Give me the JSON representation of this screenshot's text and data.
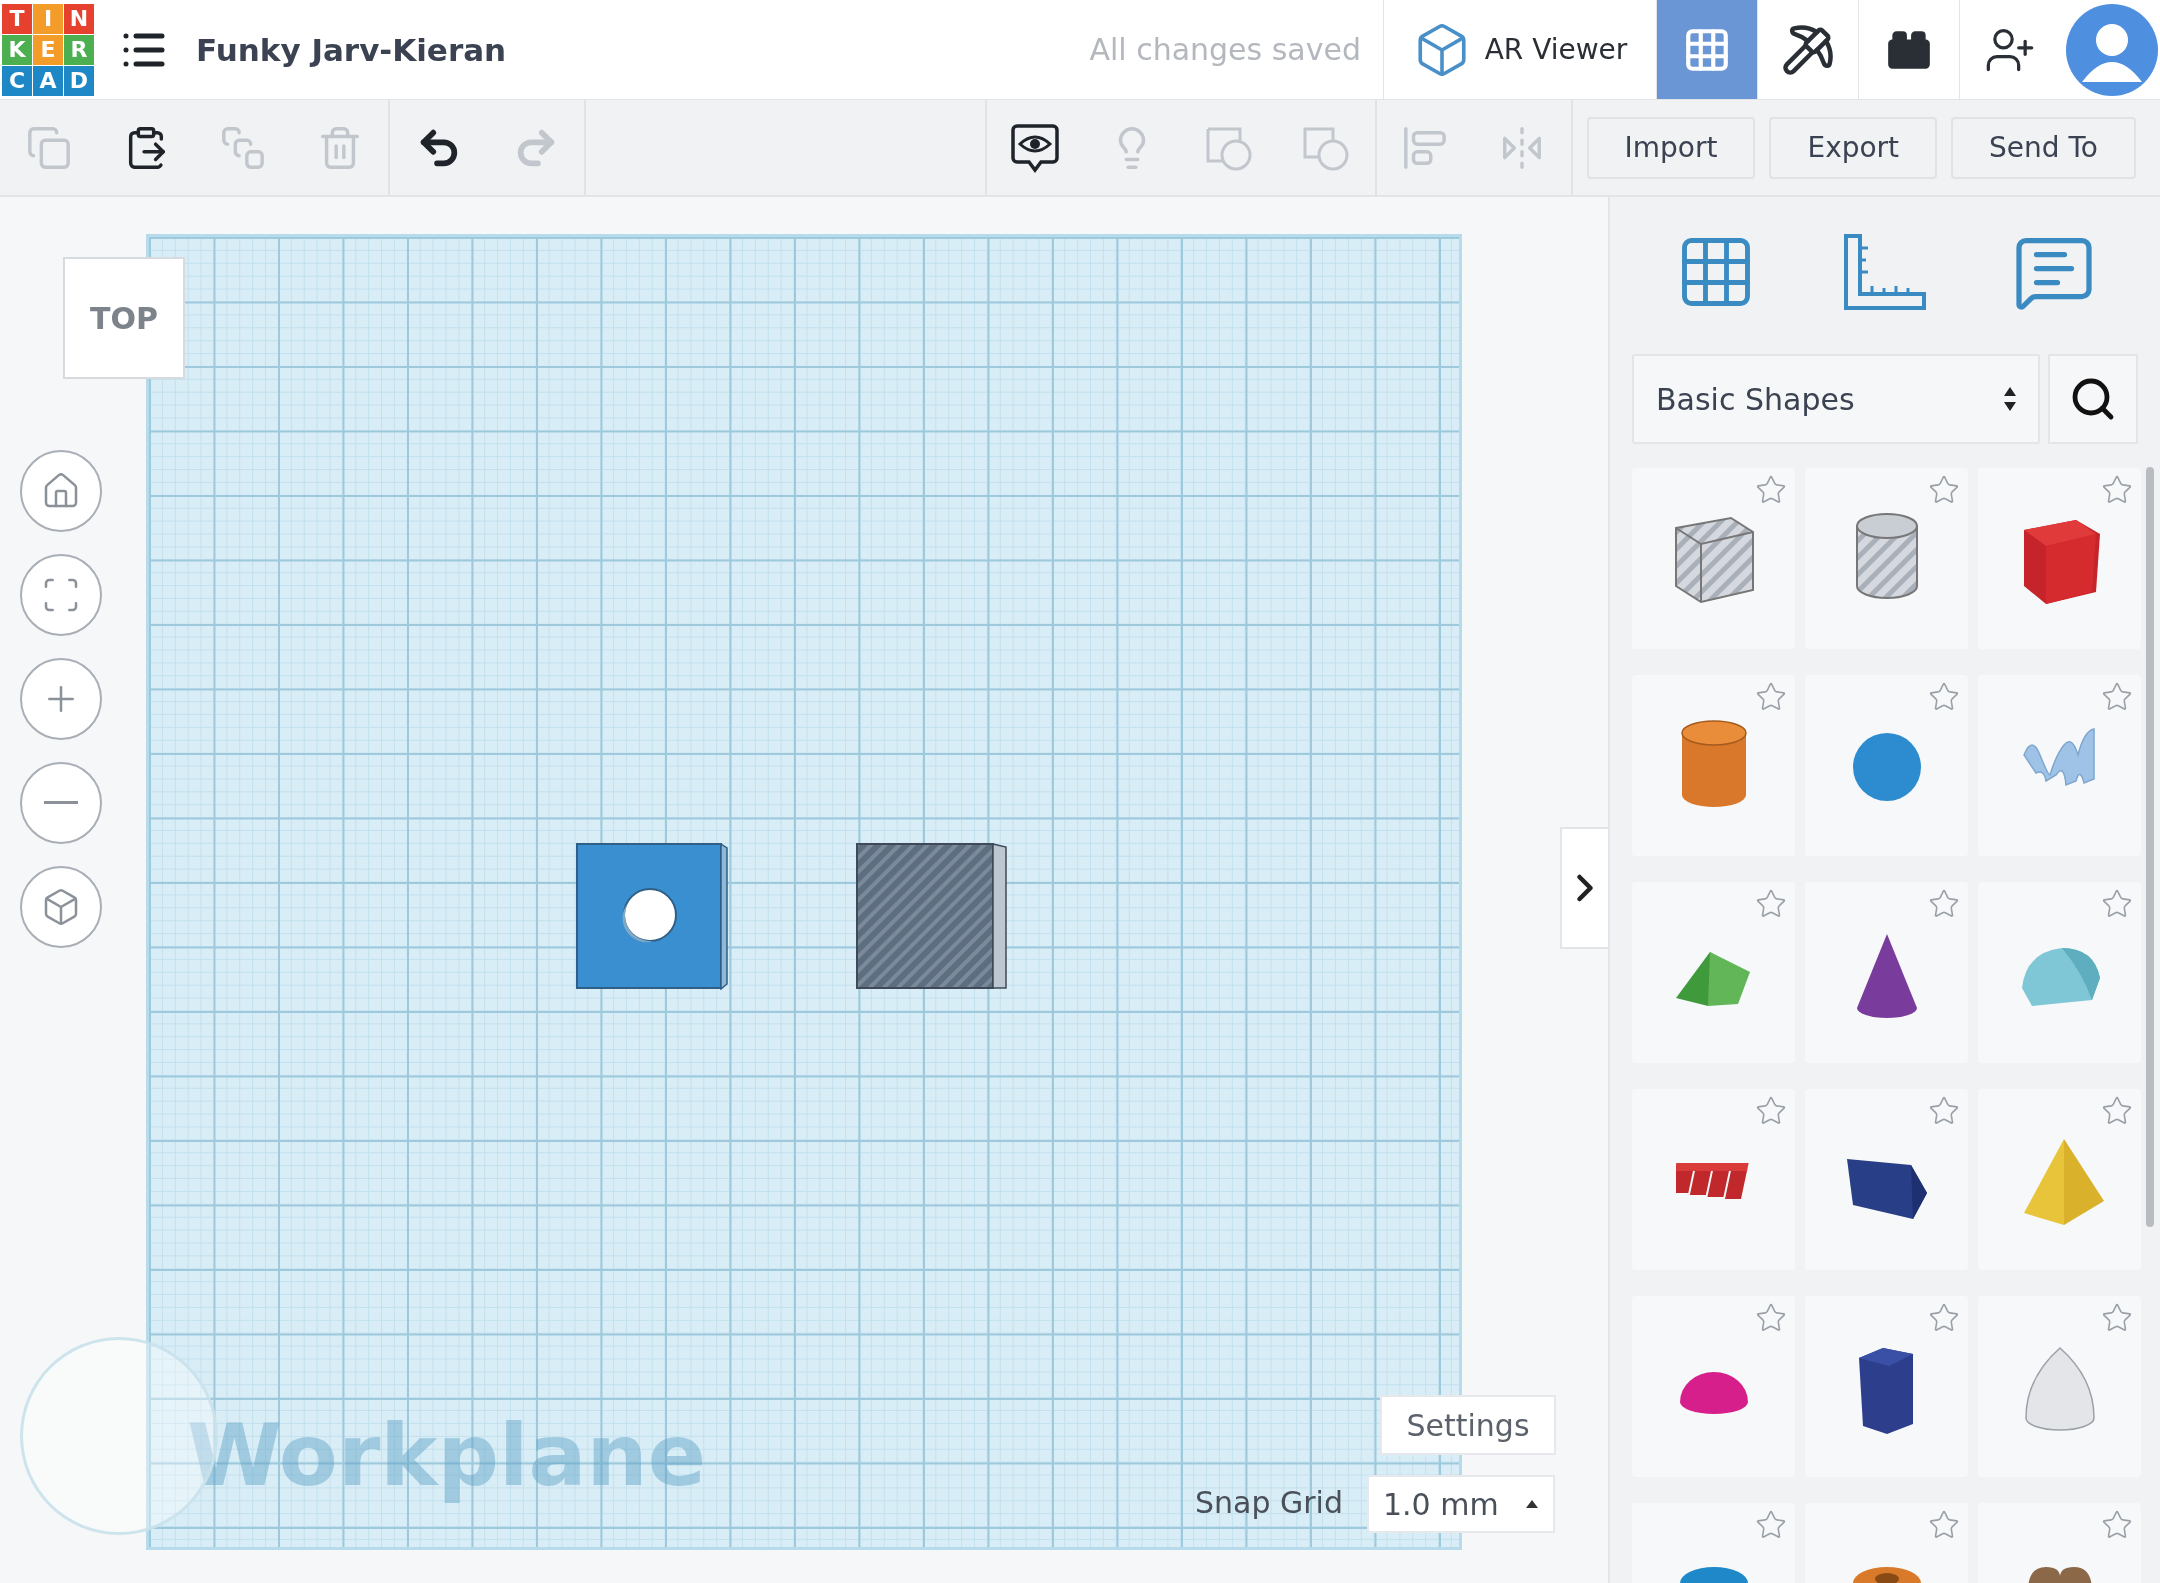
{
  "header": {
    "logo": [
      {
        "char": "T",
        "color": "#e5412e"
      },
      {
        "char": "I",
        "color": "#f39c2a"
      },
      {
        "char": "N",
        "color": "#e5412e"
      },
      {
        "char": "K",
        "color": "#4caf50"
      },
      {
        "char": "E",
        "color": "#f39c2a"
      },
      {
        "char": "R",
        "color": "#4caf50"
      },
      {
        "char": "C",
        "color": "#1e88c7"
      },
      {
        "char": "A",
        "color": "#1e88c7"
      },
      {
        "char": "D",
        "color": "#1e88c7"
      }
    ],
    "title": "Funky Jarv-Kieran",
    "save_status": "All changes saved",
    "views": [
      {
        "label": "AR Viewer",
        "selected": false
      },
      {
        "selected": true
      },
      {
        "selected": false
      },
      {
        "selected": false
      }
    ]
  },
  "toolbar": {
    "edit_tools": [
      {
        "disabled": true
      },
      {
        "disabled": false
      },
      {
        "disabled": true
      },
      {
        "disabled": true
      },
      {
        "disabled": false
      },
      {
        "disabled": true
      }
    ],
    "shape_tools": [
      {
        "disabled": false
      },
      {
        "disabled": true
      },
      {
        "disabled": true
      },
      {
        "disabled": true
      },
      {
        "disabled": true
      },
      {
        "disabled": true
      }
    ],
    "buttons": [
      "Import",
      "Export",
      "Send To"
    ]
  },
  "canvas": {
    "view_cube": "TOP",
    "workplane_label": "Workplane",
    "settings_button": "Settings",
    "snap_grid": {
      "label": "Snap Grid",
      "value": "1.0 mm"
    }
  },
  "panel": {
    "category": "Basic Shapes",
    "shapes": [
      {
        "kind": "hole-box",
        "starred": false
      },
      {
        "kind": "hole-cylinder",
        "starred": false
      },
      {
        "kind": "box",
        "starred": false
      },
      {
        "kind": "cylinder",
        "starred": false
      },
      {
        "kind": "sphere",
        "starred": false
      },
      {
        "kind": "scribble",
        "starred": false
      },
      {
        "kind": "roof",
        "starred": false
      },
      {
        "kind": "cone",
        "starred": false
      },
      {
        "kind": "round-roof",
        "starred": false
      },
      {
        "kind": "text",
        "starred": false
      },
      {
        "kind": "wedge",
        "starred": false
      },
      {
        "kind": "pyramid",
        "starred": false
      },
      {
        "kind": "half-sphere",
        "starred": false
      },
      {
        "kind": "polygon",
        "starred": false
      },
      {
        "kind": "paraboloid",
        "starred": false
      },
      {
        "kind": "torus",
        "starred": false
      },
      {
        "kind": "tube",
        "starred": false
      },
      {
        "kind": "heart",
        "starred": false
      }
    ]
  }
}
